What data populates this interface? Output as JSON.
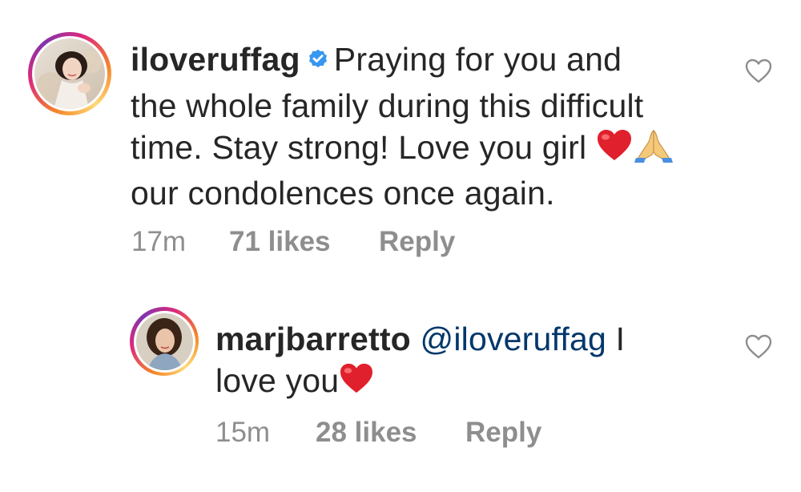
{
  "comments": [
    {
      "username": "iloveruffag",
      "verified": true,
      "text_line1": "Praying for you and",
      "text_line2": "the whole family during this difficult",
      "text_line3": "time. Stay strong! Love you girl",
      "text_line4": "our condolences once again.",
      "emoji_after_line3": [
        "red-heart",
        "folded-hands"
      ],
      "time": "17m",
      "likes": "71 likes",
      "reply": "Reply",
      "avatar": "avatar-iloveruffag",
      "like_icon": "heart-outline-icon"
    },
    {
      "username": "marjbarretto",
      "mention": "@iloveruffag",
      "text_part1": "I",
      "text_line2": "love you",
      "emoji_after_line2": [
        "red-heart"
      ],
      "time": "15m",
      "likes": "28 likes",
      "reply": "Reply",
      "avatar": "avatar-marjbarretto",
      "like_icon": "heart-outline-icon"
    }
  ],
  "colors": {
    "text": "#262626",
    "meta": "#8e8e8e",
    "mention": "#00376b",
    "verified": "#3897f0",
    "heart": "#e0202c"
  }
}
